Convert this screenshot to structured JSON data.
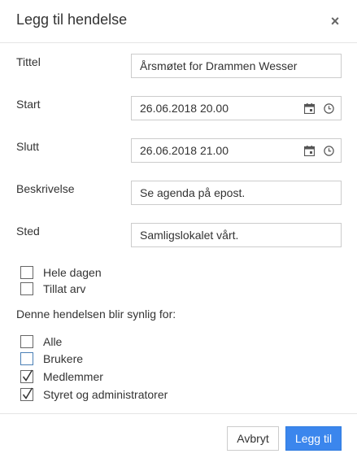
{
  "dialog": {
    "title": "Legg til hendelse",
    "close_symbol": "×",
    "close_icon": "close-icon"
  },
  "fields": {
    "title": {
      "label": "Tittel",
      "value": "Årsmøtet for Drammen Wesser"
    },
    "start": {
      "label": "Start",
      "value": "26.06.2018 20.00",
      "icons": [
        "calendar-icon",
        "clock-icon"
      ]
    },
    "end": {
      "label": "Slutt",
      "value": "26.06.2018 21.00",
      "icons": [
        "calendar-icon",
        "clock-icon"
      ]
    },
    "description": {
      "label": "Beskrivelse",
      "value": "Se agenda på epost."
    },
    "location": {
      "label": "Sted",
      "value": "Samligslokalet vårt."
    }
  },
  "options": [
    {
      "label": "Hele dagen",
      "checked": false
    },
    {
      "label": "Tillat arv",
      "checked": false
    }
  ],
  "visibility": {
    "heading": "Denne hendelsen blir synlig for:",
    "items": [
      {
        "label": "Alle",
        "checked": false
      },
      {
        "label": "Brukere",
        "checked": false
      },
      {
        "label": "Medlemmer",
        "checked": true
      },
      {
        "label": "Styret og administratorer",
        "checked": true
      }
    ]
  },
  "buttons": {
    "cancel": "Avbryt",
    "add": "Legg til"
  },
  "colors": {
    "primary": "#3b86ed",
    "border": "#cccccc",
    "text": "#333333"
  }
}
